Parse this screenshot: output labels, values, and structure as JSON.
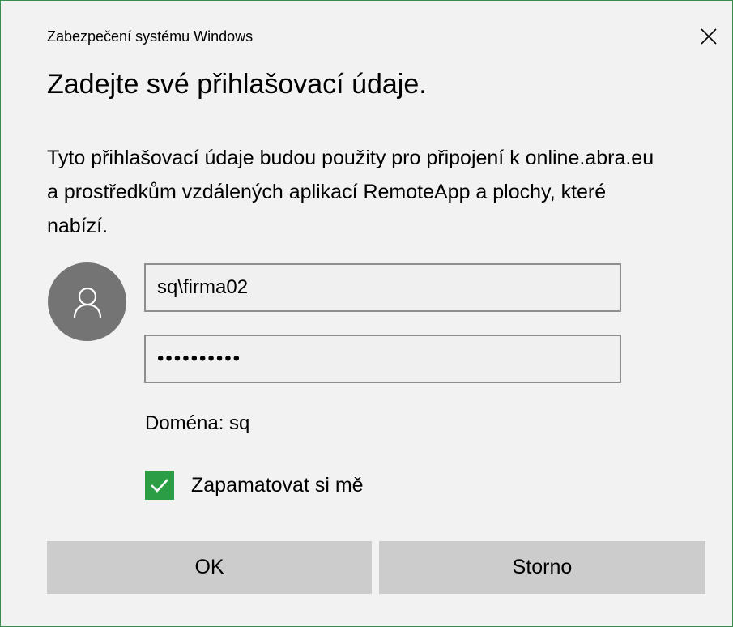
{
  "window": {
    "title": "Zabezpečení systému Windows",
    "close_icon": "close-icon"
  },
  "dialog": {
    "heading": "Zadejte své přihlašovací údaje.",
    "description": "Tyto přihlašovací údaje budou použity pro připojení k online.abra.eu a prostředkům vzdálených aplikací RemoteApp a plochy, které nabízí."
  },
  "credentials": {
    "avatar_icon": "user-icon",
    "username": "sq\\firma02",
    "password": "••••••••••",
    "domain_label": "Doména: sq"
  },
  "remember_me": {
    "label": "Zapamatovat si mě",
    "checked": true,
    "checkbox_color": "#2a9d45"
  },
  "buttons": {
    "ok": "OK",
    "cancel": "Storno"
  },
  "colors": {
    "window_border": "#3c8a4c",
    "background": "#f2f2f2",
    "button_bg": "#cccccc",
    "avatar_bg": "#747474"
  }
}
